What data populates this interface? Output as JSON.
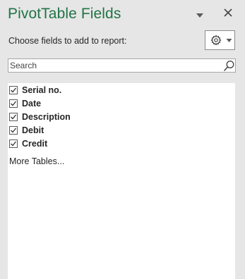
{
  "pane": {
    "title": "PivotTable Fields",
    "choose_label": "Choose fields to add to report:",
    "options_icon": "chevron-down-icon",
    "close_icon": "close-icon",
    "settings_icon": "gear-icon"
  },
  "search": {
    "placeholder": "Search",
    "value": "",
    "icon": "search-icon"
  },
  "fields": [
    {
      "label": "Serial no.",
      "checked": true
    },
    {
      "label": "Date",
      "checked": true
    },
    {
      "label": "Description",
      "checked": true
    },
    {
      "label": "Debit",
      "checked": true
    },
    {
      "label": "Credit",
      "checked": true
    }
  ],
  "more_tables_label": "More Tables...",
  "colors": {
    "title": "#217346",
    "background": "#e6e6e6",
    "list_background": "#ffffff"
  }
}
